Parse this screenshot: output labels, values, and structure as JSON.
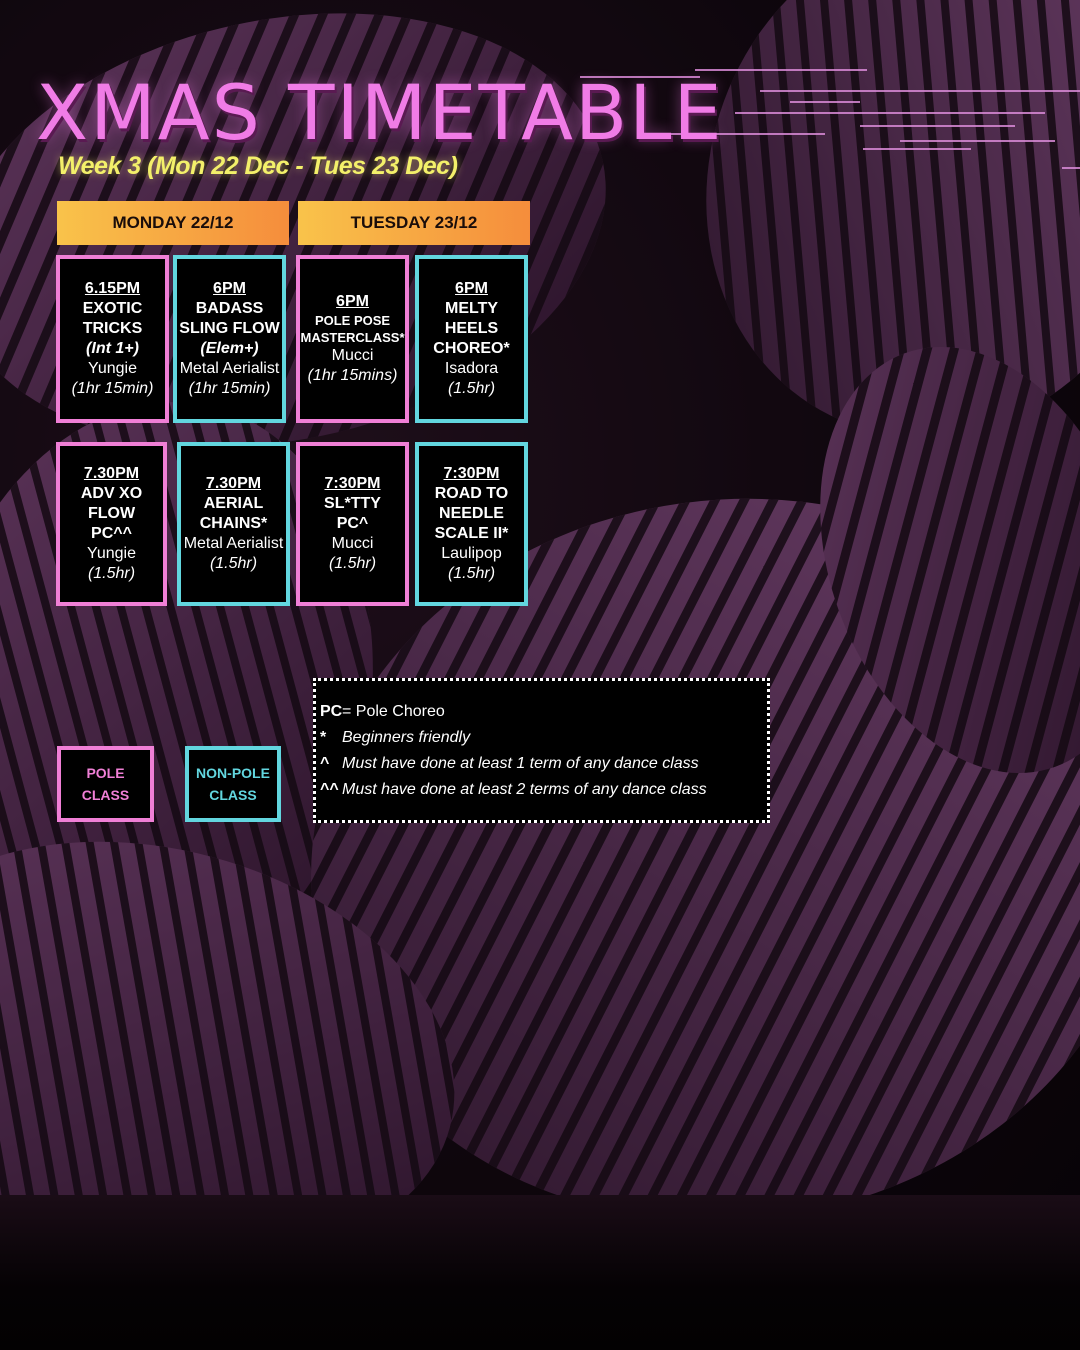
{
  "title": "XMAS TIMETABLE",
  "subtitle": "Week 3  (Mon 22 Dec - Tues 23 Dec)",
  "days": [
    {
      "label": "MONDAY 22/12"
    },
    {
      "label": "TUESDAY 23/12"
    }
  ],
  "classes": [
    {
      "time": "6.15PM",
      "name": "EXOTIC\nTRICKS",
      "level": "(Int 1+)",
      "teacher": "Yungie",
      "duration": "(1hr 15min)",
      "type": "pole"
    },
    {
      "time": "6PM",
      "name": "BADASS\nSLING FLOW",
      "level": "(Elem+)",
      "teacher": "Metal Aerialist",
      "duration": "(1hr 15min)",
      "type": "non-pole"
    },
    {
      "time": "6PM",
      "name": "POLE POSE\nMASTERCLASS*",
      "level": "",
      "teacher": "Mucci",
      "duration": "(1hr 15mins)",
      "type": "pole"
    },
    {
      "time": "6PM",
      "name": "MELTY HEELS\nCHOREO*",
      "level": "",
      "teacher": "Isadora",
      "duration": "(1.5hr)",
      "type": "non-pole"
    },
    {
      "time": "7.30PM",
      "name": "ADV XO FLOW\nPC^^",
      "level": "",
      "teacher": "Yungie",
      "duration": "(1.5hr)",
      "type": "pole"
    },
    {
      "time": "7.30PM",
      "name": "AERIAL\nCHAINS*",
      "level": "",
      "teacher": "Metal Aerialist",
      "duration": "(1.5hr)",
      "type": "non-pole"
    },
    {
      "time": "7:30PM",
      "name": "SL*TTY\nPC^",
      "level": "",
      "teacher": "Mucci",
      "duration": "(1.5hr)",
      "type": "pole"
    },
    {
      "time": "7:30PM",
      "name": "ROAD TO\nNEEDLE\nSCALE II*",
      "level": "",
      "teacher": "Laulipop",
      "duration": "(1.5hr)",
      "type": "non-pole"
    }
  ],
  "legend": {
    "pole": "POLE CLASS",
    "non_pole": "NON-POLE\nCLASS"
  },
  "key": [
    {
      "symbol": "PC",
      "text": "= Pole Choreo",
      "italic": false
    },
    {
      "symbol": "*",
      "text": "Beginners friendly",
      "italic": true
    },
    {
      "symbol": "^",
      "text": "Must have done at least 1 term of any dance class",
      "italic": true
    },
    {
      "symbol": "^^",
      "text": "Must have done at least 2 terms of any dance class",
      "italic": true
    }
  ],
  "colors": {
    "pole": "#f07fd6",
    "non_pole": "#62d6df",
    "title": "#f07ce6",
    "subtitle": "#f3f06a",
    "header_gradient_start": "#f9c34a",
    "header_gradient_end": "#f58d3c"
  }
}
